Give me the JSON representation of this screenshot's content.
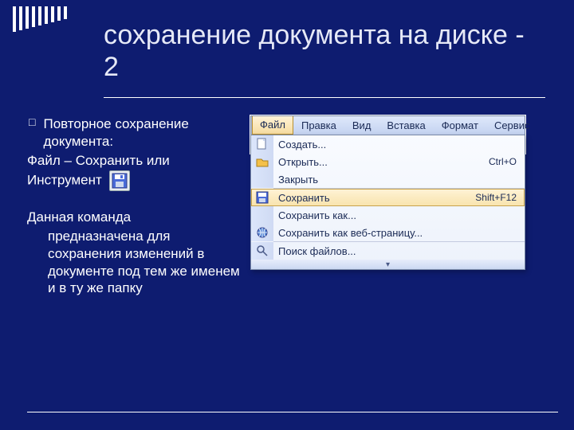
{
  "title": "сохранение документа на диске - 2",
  "left": {
    "bullet": "Повторное сохранение документа:",
    "line1": "Файл – Сохранить или",
    "line2": "Инструмент",
    "para2a": "Данная команда",
    "para2b": "предназначена для сохранения изменений в документе под тем же именем и в ту же папку"
  },
  "menubar": {
    "items": [
      "Файл",
      "Правка",
      "Вид",
      "Вставка",
      "Формат",
      "Сервис"
    ]
  },
  "dropdown": {
    "rows": [
      {
        "icon": "new",
        "label": "Создать...",
        "accel": ""
      },
      {
        "icon": "open",
        "label": "Открыть...",
        "accel": "Ctrl+O"
      },
      {
        "icon": "",
        "label": "Закрыть",
        "accel": ""
      },
      {
        "sep": true
      },
      {
        "icon": "save",
        "label": "Сохранить",
        "accel": "Shift+F12",
        "highlight": true
      },
      {
        "icon": "",
        "label": "Сохранить как...",
        "accel": ""
      },
      {
        "icon": "saveweb",
        "label": "Сохранить как веб-страницу...",
        "accel": ""
      },
      {
        "sep": true
      },
      {
        "icon": "search",
        "label": "Поиск файлов...",
        "accel": ""
      }
    ]
  }
}
